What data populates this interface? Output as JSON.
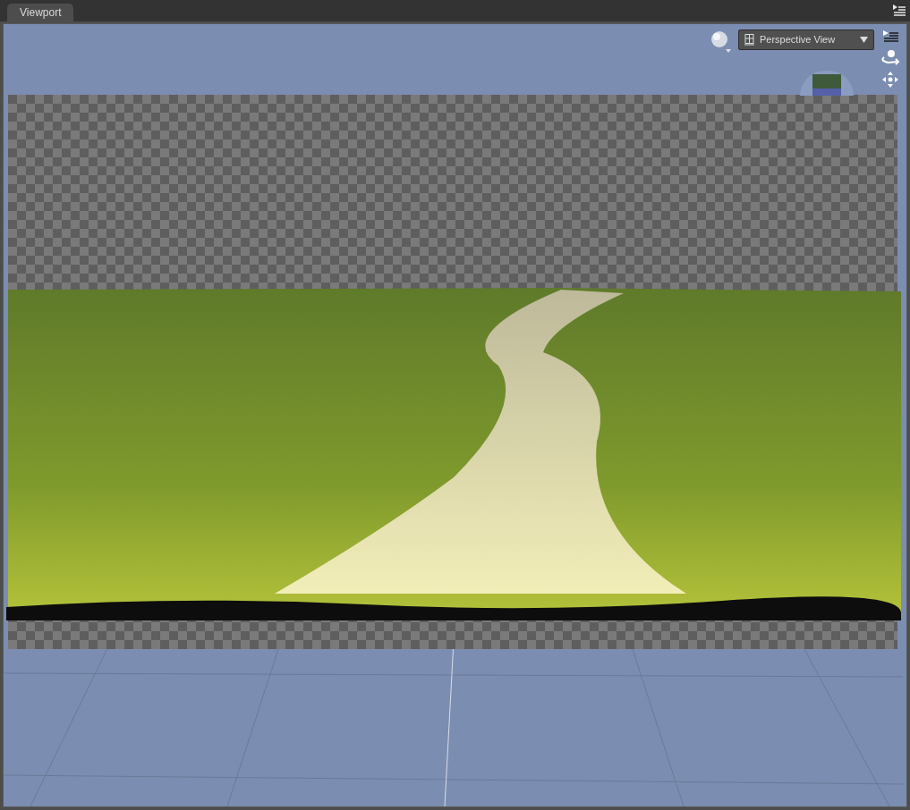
{
  "tabs": [
    {
      "label": "Viewport",
      "selected": true
    }
  ],
  "view_selector": {
    "value": "Perspective View"
  }
}
